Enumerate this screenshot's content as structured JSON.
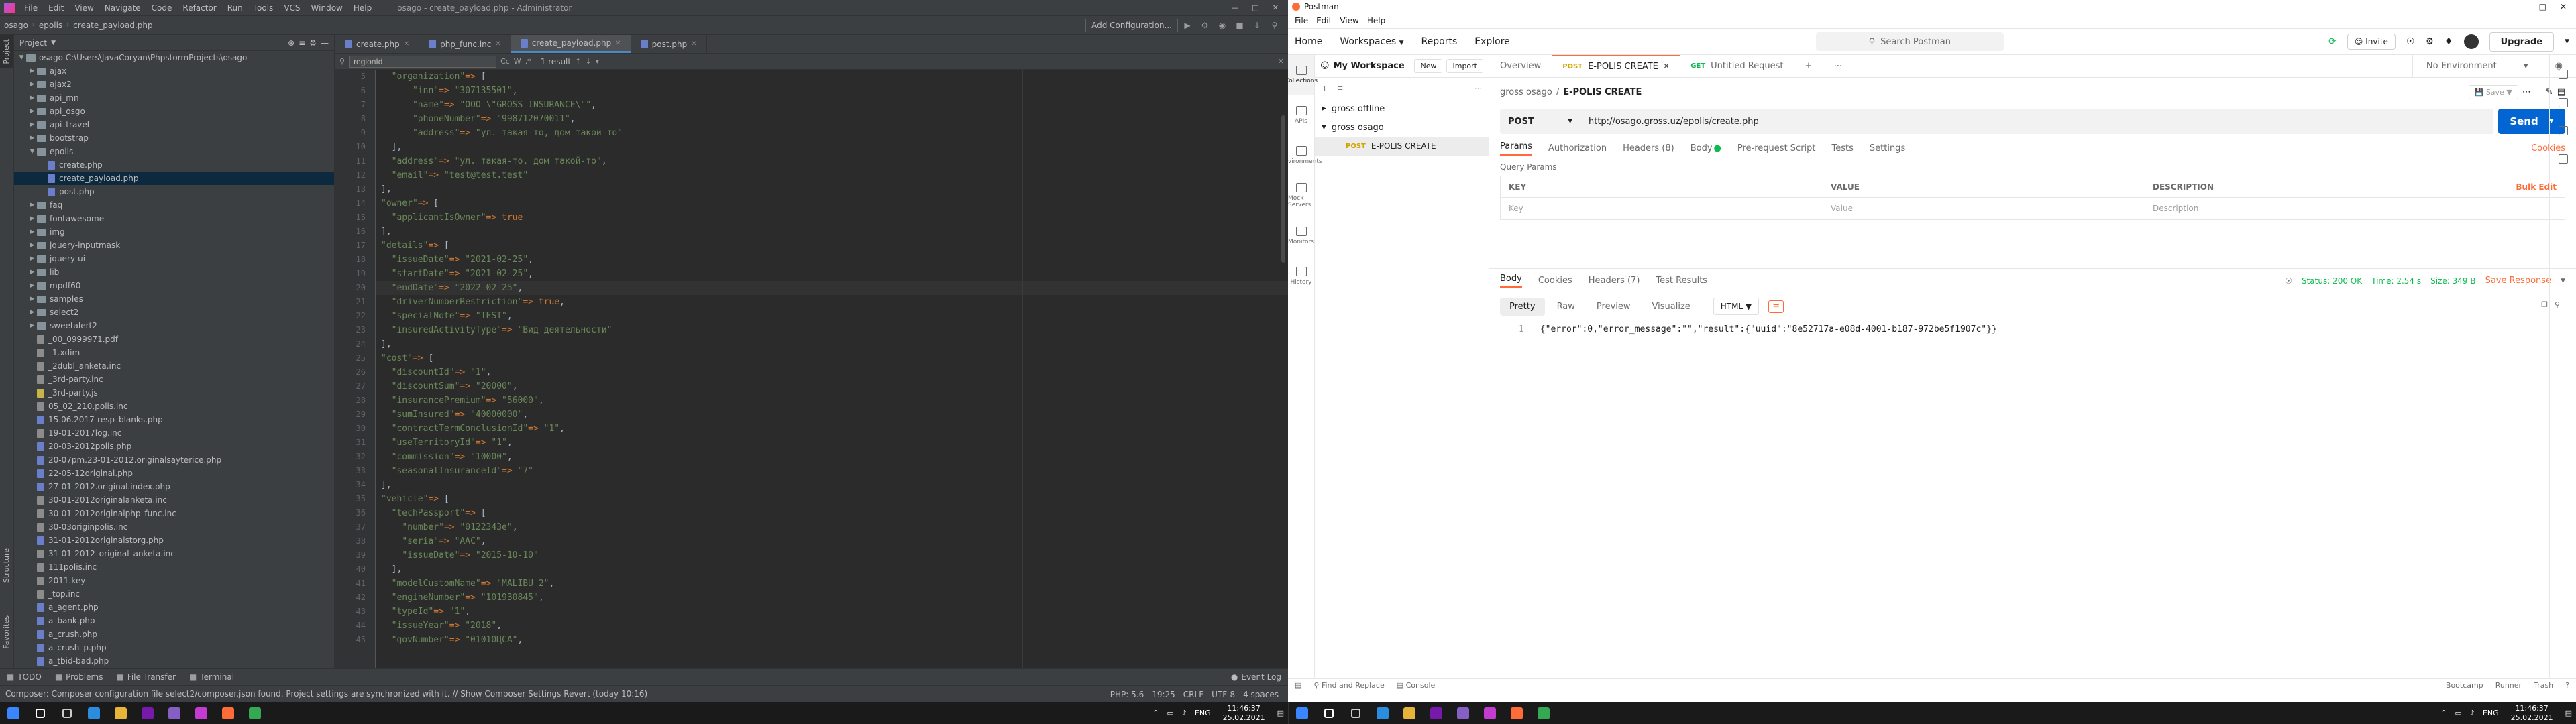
{
  "phpstorm": {
    "title": "osago - create_payload.php - Administrator",
    "menu": [
      "File",
      "Edit",
      "View",
      "Navigate",
      "Code",
      "Refactor",
      "Run",
      "Tools",
      "VCS",
      "Window",
      "Help"
    ],
    "breadcrumb": [
      "osago",
      "epolis",
      "create_payload.php"
    ],
    "add_config": "Add Configuration...",
    "project_label": "Project",
    "tree": [
      {
        "label": "osago  C:\\Users\\JavaCoryan\\PhpstormProjects\\osago",
        "type": "folder",
        "depth": 0,
        "open": true
      },
      {
        "label": "ajax",
        "type": "folder",
        "depth": 1
      },
      {
        "label": "ajax2",
        "type": "folder",
        "depth": 1
      },
      {
        "label": "api_mn",
        "type": "folder",
        "depth": 1
      },
      {
        "label": "api_osgo",
        "type": "folder",
        "depth": 1
      },
      {
        "label": "api_travel",
        "type": "folder",
        "depth": 1
      },
      {
        "label": "bootstrap",
        "type": "folder",
        "depth": 1
      },
      {
        "label": "epolis",
        "type": "folder",
        "depth": 1,
        "open": true
      },
      {
        "label": "create.php",
        "type": "file",
        "depth": 2
      },
      {
        "label": "create_payload.php",
        "type": "file",
        "depth": 2,
        "selected": true
      },
      {
        "label": "post.php",
        "type": "file",
        "depth": 2
      },
      {
        "label": "faq",
        "type": "folder",
        "depth": 1
      },
      {
        "label": "fontawesome",
        "type": "folder",
        "depth": 1
      },
      {
        "label": "img",
        "type": "folder",
        "depth": 1
      },
      {
        "label": "jquery-inputmask",
        "type": "folder",
        "depth": 1
      },
      {
        "label": "jquery-ui",
        "type": "folder",
        "depth": 1
      },
      {
        "label": "lib",
        "type": "folder",
        "depth": 1
      },
      {
        "label": "mpdf60",
        "type": "folder",
        "depth": 1
      },
      {
        "label": "samples",
        "type": "folder",
        "depth": 1
      },
      {
        "label": "select2",
        "type": "folder",
        "depth": 1
      },
      {
        "label": "sweetalert2",
        "type": "folder",
        "depth": 1
      },
      {
        "label": "_00_0999971.pdf",
        "type": "txt",
        "depth": 1
      },
      {
        "label": "_1.xdim",
        "type": "txt",
        "depth": 1
      },
      {
        "label": "_2dubl_anketa.inc",
        "type": "txt",
        "depth": 1
      },
      {
        "label": "_3rd-party.inc",
        "type": "txt",
        "depth": 1
      },
      {
        "label": "_3rd-party.js",
        "type": "js",
        "depth": 1
      },
      {
        "label": "05_02_210.polis.inc",
        "type": "txt",
        "depth": 1
      },
      {
        "label": "15.06.2017-resp_blanks.php",
        "type": "file",
        "depth": 1
      },
      {
        "label": "19-01-2017log.inc",
        "type": "txt",
        "depth": 1
      },
      {
        "label": "20-03-2012polis.php",
        "type": "file",
        "depth": 1
      },
      {
        "label": "20-07pm.23-01-2012.originalsayterice.php",
        "type": "file",
        "depth": 1
      },
      {
        "label": "22-05-12original.php",
        "type": "file",
        "depth": 1
      },
      {
        "label": "27-01-2012.original.index.php",
        "type": "file",
        "depth": 1
      },
      {
        "label": "30-01-2012originalanketa.inc",
        "type": "txt",
        "depth": 1
      },
      {
        "label": "30-01-2012originalphp_func.inc",
        "type": "txt",
        "depth": 1
      },
      {
        "label": "30-03originpolis.inc",
        "type": "txt",
        "depth": 1
      },
      {
        "label": "31-01-2012originalstorg.php",
        "type": "file",
        "depth": 1
      },
      {
        "label": "31-01-2012_original_anketa.inc",
        "type": "txt",
        "depth": 1
      },
      {
        "label": "111polis.inc",
        "type": "txt",
        "depth": 1
      },
      {
        "label": "2011.key",
        "type": "txt",
        "depth": 1
      },
      {
        "label": "_top.inc",
        "type": "txt",
        "depth": 1
      },
      {
        "label": "a_agent.php",
        "type": "file",
        "depth": 1
      },
      {
        "label": "a_bank.php",
        "type": "file",
        "depth": 1
      },
      {
        "label": "a_crush.php",
        "type": "file",
        "depth": 1
      },
      {
        "label": "a_crush_p.php",
        "type": "file",
        "depth": 1
      },
      {
        "label": "a_tbid-bad.php",
        "type": "file",
        "depth": 1
      }
    ],
    "tabs": [
      {
        "label": "create.php",
        "active": false
      },
      {
        "label": "php_func.inc",
        "active": false
      },
      {
        "label": "create_payload.php",
        "active": true
      },
      {
        "label": "post.php",
        "active": false
      }
    ],
    "find": {
      "value": "regionId",
      "result": "1 result"
    },
    "first_line": 5,
    "code": [
      "  \"organization\"=> [",
      "      \"inn\"=> \"307135501\",",
      "      \"name\"=> \"ООО \\\"GROSS INSURANCE\\\"\",",
      "      \"phoneNumber\"=> \"998712070011\",",
      "      \"address\"=> \"ул. такая-то, дом такой-то\"",
      "  ],",
      "  \"address\"=> \"ул. такая-то, дом такой-то\",",
      "  \"email\"=> \"test@test.test\"",
      "],",
      "\"owner\"=> [",
      "  \"applicantIsOwner\"=> true",
      "],",
      "\"details\"=> [",
      "  \"issueDate\"=> \"2021-02-25\",",
      "  \"startDate\"=> \"2021-02-25\",",
      "  \"endDate\"=> \"2022-02-25\",",
      "  \"driverNumberRestriction\"=> true,",
      "  \"specialNote\"=> \"TEST\",",
      "  \"insuredActivityType\"=> \"Вид деятельности\"",
      "],",
      "\"cost\"=> [",
      "  \"discountId\"=> \"1\",",
      "  \"discountSum\"=> \"20000\",",
      "  \"insurancePremium\"=> \"56000\",",
      "  \"sumInsured\"=> \"40000000\",",
      "  \"contractTermConclusionId\"=> \"1\",",
      "  \"useTerritoryId\"=> \"1\",",
      "  \"commission\"=> \"10000\",",
      "  \"seasonalInsuranceId\"=> \"7\"",
      "],",
      "\"vehicle\"=> [",
      "  \"techPassport\"=> [",
      "    \"number\"=> \"0122343e\",",
      "    \"seria\"=> \"AAC\",",
      "    \"issueDate\"=> \"2015-10-10\"",
      "  ],",
      "  \"modelCustomName\"=> \"MALIBU 2\",",
      "  \"engineNumber\"=> \"101930845\",",
      "  \"typeId\"=> \"1\",",
      "  \"issueYear\"=> \"2018\",",
      "  \"govNumber\"=> \"01010ЦСА\","
    ],
    "current_line_index": 15,
    "toolwindows": [
      "TODO",
      "Problems",
      "File Transfer",
      "Terminal"
    ],
    "event_log": "Event Log",
    "status_message": "Composer: Composer configuration file select2/composer.json found. Project settings are synchronized with it. // Show Composer Settings   Revert (today 10:16)",
    "status_right": [
      "PHP: 5.6",
      "19:25",
      "CRLF",
      "UTF-8",
      "4 spaces"
    ],
    "left_vtabs": [
      "Project",
      "Structure",
      "Favorites"
    ]
  },
  "postman": {
    "title": "Postman",
    "menu": [
      "File",
      "Edit",
      "View",
      "Help"
    ],
    "nav": [
      "Home",
      "Workspaces",
      "Reports",
      "Explore"
    ],
    "search_placeholder": "Search Postman",
    "invite": "Invite",
    "upgrade": "Upgrade",
    "sidebar": [
      "Collections",
      "APIs",
      "Environments",
      "Mock Servers",
      "Monitors",
      "History"
    ],
    "workspace": "My Workspace",
    "new_btn": "New",
    "import_btn": "Import",
    "collections": [
      "gross offline",
      "gross osago"
    ],
    "request_item": {
      "method": "POST",
      "name": "E-POLIS CREATE"
    },
    "tabs": [
      {
        "label": "Overview",
        "method": ""
      },
      {
        "label": "E-POLIS CREATE",
        "method": "POST"
      },
      {
        "label": "Untitled Request",
        "method": "GET"
      }
    ],
    "env": "No Environment",
    "req_path": {
      "parent": "gross osago",
      "name": "E-POLIS CREATE"
    },
    "save": "Save",
    "method": "POST",
    "url": "http://osago.gross.uz/epolis/create.php",
    "send": "Send",
    "req_tabs": [
      "Params",
      "Authorization",
      "Headers (8)",
      "Body",
      "Pre-request Script",
      "Tests",
      "Settings"
    ],
    "cookies": "Cookies",
    "query_params": "Query Params",
    "table_headers": [
      "KEY",
      "VALUE",
      "DESCRIPTION"
    ],
    "table_placeholders": [
      "Key",
      "Value",
      "Description"
    ],
    "bulk_edit": "Bulk Edit",
    "resp_tabs": [
      "Body",
      "Cookies",
      "Headers (7)",
      "Test Results"
    ],
    "status": {
      "status": "Status: 200 OK",
      "time": "Time: 2.54 s",
      "size": "Size: 349 B"
    },
    "save_response": "Save Response",
    "views": [
      "Pretty",
      "Raw",
      "Preview",
      "Visualize"
    ],
    "format": "HTML",
    "response_line_number": "1",
    "response_body": "{\"error\":0,\"error_message\":\"\",\"result\":{\"uuid\":\"8e52717a-e08d-4001-b187-972be5f1907c\"}}",
    "footer": [
      "Find and Replace",
      "Console"
    ],
    "footer_right": [
      "Bootcamp",
      "Runner",
      "Trash"
    ]
  },
  "taskbar": {
    "left_clock": {
      "time": "11:46:37",
      "date": "25.02.2021"
    },
    "right_clock": {
      "time": "11:46:37",
      "date": "25.02.2021"
    },
    "lang": "ENG"
  }
}
